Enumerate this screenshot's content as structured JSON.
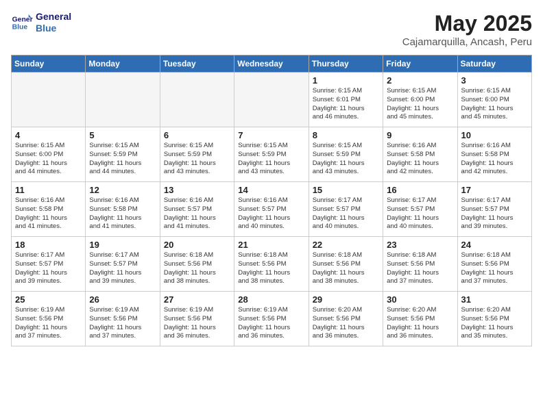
{
  "header": {
    "logo_line1": "General",
    "logo_line2": "Blue",
    "month": "May 2025",
    "location": "Cajamarquilla, Ancash, Peru"
  },
  "days_of_week": [
    "Sunday",
    "Monday",
    "Tuesday",
    "Wednesday",
    "Thursday",
    "Friday",
    "Saturday"
  ],
  "weeks": [
    [
      {
        "day": "",
        "info": "",
        "empty": true
      },
      {
        "day": "",
        "info": "",
        "empty": true
      },
      {
        "day": "",
        "info": "",
        "empty": true
      },
      {
        "day": "",
        "info": "",
        "empty": true
      },
      {
        "day": "1",
        "info": "Sunrise: 6:15 AM\nSunset: 6:01 PM\nDaylight: 11 hours\nand 46 minutes."
      },
      {
        "day": "2",
        "info": "Sunrise: 6:15 AM\nSunset: 6:00 PM\nDaylight: 11 hours\nand 45 minutes."
      },
      {
        "day": "3",
        "info": "Sunrise: 6:15 AM\nSunset: 6:00 PM\nDaylight: 11 hours\nand 45 minutes."
      }
    ],
    [
      {
        "day": "4",
        "info": "Sunrise: 6:15 AM\nSunset: 6:00 PM\nDaylight: 11 hours\nand 44 minutes."
      },
      {
        "day": "5",
        "info": "Sunrise: 6:15 AM\nSunset: 5:59 PM\nDaylight: 11 hours\nand 44 minutes."
      },
      {
        "day": "6",
        "info": "Sunrise: 6:15 AM\nSunset: 5:59 PM\nDaylight: 11 hours\nand 43 minutes."
      },
      {
        "day": "7",
        "info": "Sunrise: 6:15 AM\nSunset: 5:59 PM\nDaylight: 11 hours\nand 43 minutes."
      },
      {
        "day": "8",
        "info": "Sunrise: 6:15 AM\nSunset: 5:59 PM\nDaylight: 11 hours\nand 43 minutes."
      },
      {
        "day": "9",
        "info": "Sunrise: 6:16 AM\nSunset: 5:58 PM\nDaylight: 11 hours\nand 42 minutes."
      },
      {
        "day": "10",
        "info": "Sunrise: 6:16 AM\nSunset: 5:58 PM\nDaylight: 11 hours\nand 42 minutes."
      }
    ],
    [
      {
        "day": "11",
        "info": "Sunrise: 6:16 AM\nSunset: 5:58 PM\nDaylight: 11 hours\nand 41 minutes."
      },
      {
        "day": "12",
        "info": "Sunrise: 6:16 AM\nSunset: 5:58 PM\nDaylight: 11 hours\nand 41 minutes."
      },
      {
        "day": "13",
        "info": "Sunrise: 6:16 AM\nSunset: 5:57 PM\nDaylight: 11 hours\nand 41 minutes."
      },
      {
        "day": "14",
        "info": "Sunrise: 6:16 AM\nSunset: 5:57 PM\nDaylight: 11 hours\nand 40 minutes."
      },
      {
        "day": "15",
        "info": "Sunrise: 6:17 AM\nSunset: 5:57 PM\nDaylight: 11 hours\nand 40 minutes."
      },
      {
        "day": "16",
        "info": "Sunrise: 6:17 AM\nSunset: 5:57 PM\nDaylight: 11 hours\nand 40 minutes."
      },
      {
        "day": "17",
        "info": "Sunrise: 6:17 AM\nSunset: 5:57 PM\nDaylight: 11 hours\nand 39 minutes."
      }
    ],
    [
      {
        "day": "18",
        "info": "Sunrise: 6:17 AM\nSunset: 5:57 PM\nDaylight: 11 hours\nand 39 minutes."
      },
      {
        "day": "19",
        "info": "Sunrise: 6:17 AM\nSunset: 5:57 PM\nDaylight: 11 hours\nand 39 minutes."
      },
      {
        "day": "20",
        "info": "Sunrise: 6:18 AM\nSunset: 5:56 PM\nDaylight: 11 hours\nand 38 minutes."
      },
      {
        "day": "21",
        "info": "Sunrise: 6:18 AM\nSunset: 5:56 PM\nDaylight: 11 hours\nand 38 minutes."
      },
      {
        "day": "22",
        "info": "Sunrise: 6:18 AM\nSunset: 5:56 PM\nDaylight: 11 hours\nand 38 minutes."
      },
      {
        "day": "23",
        "info": "Sunrise: 6:18 AM\nSunset: 5:56 PM\nDaylight: 11 hours\nand 37 minutes."
      },
      {
        "day": "24",
        "info": "Sunrise: 6:18 AM\nSunset: 5:56 PM\nDaylight: 11 hours\nand 37 minutes."
      }
    ],
    [
      {
        "day": "25",
        "info": "Sunrise: 6:19 AM\nSunset: 5:56 PM\nDaylight: 11 hours\nand 37 minutes."
      },
      {
        "day": "26",
        "info": "Sunrise: 6:19 AM\nSunset: 5:56 PM\nDaylight: 11 hours\nand 37 minutes."
      },
      {
        "day": "27",
        "info": "Sunrise: 6:19 AM\nSunset: 5:56 PM\nDaylight: 11 hours\nand 36 minutes."
      },
      {
        "day": "28",
        "info": "Sunrise: 6:19 AM\nSunset: 5:56 PM\nDaylight: 11 hours\nand 36 minutes."
      },
      {
        "day": "29",
        "info": "Sunrise: 6:20 AM\nSunset: 5:56 PM\nDaylight: 11 hours\nand 36 minutes."
      },
      {
        "day": "30",
        "info": "Sunrise: 6:20 AM\nSunset: 5:56 PM\nDaylight: 11 hours\nand 36 minutes."
      },
      {
        "day": "31",
        "info": "Sunrise: 6:20 AM\nSunset: 5:56 PM\nDaylight: 11 hours\nand 35 minutes."
      }
    ]
  ]
}
